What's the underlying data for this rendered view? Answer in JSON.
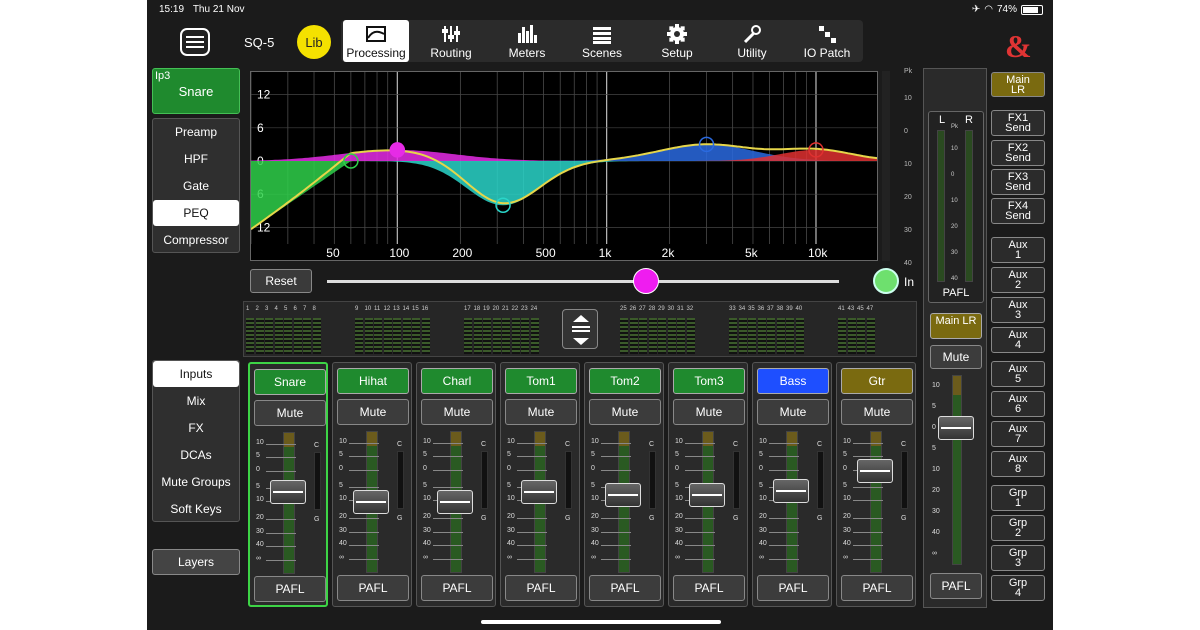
{
  "status": {
    "time": "15:19",
    "date": "Thu 21 Nov",
    "battery": "74%",
    "battery_level": 0.74
  },
  "header": {
    "model": "SQ-5",
    "lib_label": "Lib",
    "logo": "&"
  },
  "tabs": [
    {
      "label": "Processing",
      "icon": "processing-icon",
      "active": true
    },
    {
      "label": "Routing",
      "icon": "routing-icon"
    },
    {
      "label": "Meters",
      "icon": "meters-icon"
    },
    {
      "label": "Scenes",
      "icon": "scenes-icon"
    },
    {
      "label": "Setup",
      "icon": "gear-icon"
    },
    {
      "label": "Utility",
      "icon": "wrench-icon"
    },
    {
      "label": "IO Patch",
      "icon": "io-patch-icon"
    }
  ],
  "selected_channel": {
    "number": "Ip3",
    "name": "Snare"
  },
  "processing_menu": [
    "Preamp",
    "HPF",
    "Gate",
    "PEQ",
    "Compressor"
  ],
  "processing_selected": "PEQ",
  "eq": {
    "y_labels": [
      "12",
      "6",
      "0",
      "6",
      "12"
    ],
    "x_labels": [
      "50",
      "100",
      "200",
      "500",
      "1k",
      "2k",
      "5k",
      "10k"
    ],
    "pk_label": "Pk",
    "meter_scale": [
      "10",
      "0",
      "10",
      "20",
      "30",
      "40"
    ],
    "reset_label": "Reset",
    "in_label": "In",
    "bands": [
      {
        "freq": 60,
        "gain": 0,
        "color": "#2fd04a"
      },
      {
        "freq": 100,
        "gain": 2,
        "color": "#e62be6"
      },
      {
        "freq": 320,
        "gain": -8,
        "color": "#2ad5c9"
      },
      {
        "freq": 3000,
        "gain": 3,
        "color": "#2a6ae0"
      },
      {
        "freq": 10000,
        "gain": 2,
        "color": "#e03030"
      }
    ]
  },
  "overview_groups": [
    {
      "nums": [
        "1",
        "2",
        "3",
        "4",
        "5",
        "6",
        "7",
        "8"
      ]
    },
    {
      "nums": [
        "9",
        "10",
        "11",
        "12",
        "13",
        "14",
        "15",
        "16"
      ]
    },
    {
      "nums": [
        "17",
        "18",
        "19",
        "20",
        "21",
        "22",
        "23",
        "24"
      ]
    },
    {
      "nums": [
        "25",
        "26",
        "27",
        "28",
        "29",
        "30",
        "31",
        "32"
      ]
    },
    {
      "nums": [
        "33",
        "34",
        "35",
        "36",
        "37",
        "38",
        "39",
        "40"
      ]
    },
    {
      "nums": [
        "41",
        "43",
        "45",
        "47"
      ]
    }
  ],
  "layer_menu": [
    "Inputs",
    "Mix",
    "FX",
    "DCAs",
    "Mute Groups",
    "Soft Keys"
  ],
  "layer_selected": "Inputs",
  "layers_label": "Layers",
  "fader_scale": [
    "10",
    "5",
    "0",
    "5",
    "10",
    "20",
    "30",
    "40",
    "∞"
  ],
  "meter_labels": {
    "c": "C",
    "g": "G"
  },
  "strips": [
    {
      "name": "Snare",
      "color": "#1f8a2e",
      "mute": "Mute",
      "pafl": "PAFL",
      "level": 0.58,
      "selected": true
    },
    {
      "name": "Hihat",
      "color": "#1f8a2e",
      "mute": "Mute",
      "pafl": "PAFL",
      "level": 0.5
    },
    {
      "name": "Charl",
      "color": "#1f8a2e",
      "mute": "Mute",
      "pafl": "PAFL",
      "level": 0.5
    },
    {
      "name": "Tom1",
      "color": "#1f8a2e",
      "mute": "Mute",
      "pafl": "PAFL",
      "level": 0.57
    },
    {
      "name": "Tom2",
      "color": "#1f8a2e",
      "mute": "Mute",
      "pafl": "PAFL",
      "level": 0.55
    },
    {
      "name": "Tom3",
      "color": "#1f8a2e",
      "mute": "Mute",
      "pafl": "PAFL",
      "level": 0.55
    },
    {
      "name": "Bass",
      "color": "#1e4fff",
      "mute": "Mute",
      "pafl": "PAFL",
      "level": 0.58
    },
    {
      "name": "Gtr",
      "color": "#7a6a10",
      "mute": "Mute",
      "pafl": "PAFL",
      "level": 0.72
    }
  ],
  "master": {
    "main_label": "Main LR",
    "meter_l": "L",
    "meter_r": "R",
    "pk": "Pk",
    "meter_scale": [
      "10",
      "0",
      "10",
      "20",
      "30",
      "40"
    ],
    "pafl_top": "PAFL",
    "mute": "Mute",
    "pafl_bottom": "PAFL",
    "fader_scale": [
      "10",
      "5",
      "0",
      "5",
      "10",
      "20",
      "30",
      "40",
      "∞"
    ],
    "level": 0.72
  },
  "mix_buttons": [
    {
      "label": "Main\nLR",
      "color": "#7a6a10"
    },
    {
      "label": "FX1\nSend"
    },
    {
      "label": "FX2\nSend"
    },
    {
      "label": "FX3\nSend"
    },
    {
      "label": "FX4\nSend"
    },
    {
      "label": "Aux\n1"
    },
    {
      "label": "Aux\n2"
    },
    {
      "label": "Aux\n3"
    },
    {
      "label": "Aux\n4"
    },
    {
      "label": "Aux\n5"
    },
    {
      "label": "Aux\n6"
    },
    {
      "label": "Aux\n7"
    },
    {
      "label": "Aux\n8"
    },
    {
      "label": "Grp\n1"
    },
    {
      "label": "Grp\n2"
    },
    {
      "label": "Grp\n3"
    },
    {
      "label": "Grp\n4"
    }
  ]
}
